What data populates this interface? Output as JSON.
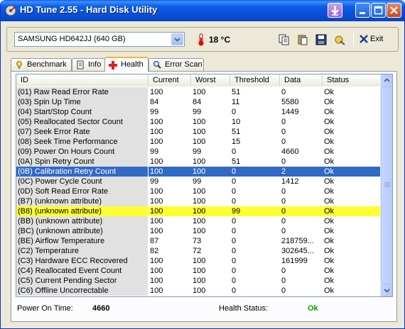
{
  "window": {
    "title": "HD Tune 2.55 - Hard Disk Utility"
  },
  "toolbar": {
    "drive": "SAMSUNG HD642JJ (640 GB)",
    "temperature": "18 °C",
    "exit_label": "Exit"
  },
  "tabs": [
    {
      "label": "Benchmark",
      "icon": "benchmark-icon",
      "active": false
    },
    {
      "label": "Info",
      "icon": "info-icon",
      "active": false
    },
    {
      "label": "Health",
      "icon": "health-cross-icon",
      "active": true
    },
    {
      "label": "Error Scan",
      "icon": "magnifier-icon",
      "active": false
    }
  ],
  "table": {
    "columns": [
      "ID",
      "Current",
      "Worst",
      "Threshold",
      "Data",
      "Status"
    ],
    "rows": [
      {
        "id": "(01) Raw Read Error Rate",
        "current": "100",
        "worst": "100",
        "threshold": "51",
        "data": "0",
        "status": "Ok"
      },
      {
        "id": "(03) Spin Up Time",
        "current": "84",
        "worst": "84",
        "threshold": "11",
        "data": "5580",
        "status": "Ok"
      },
      {
        "id": "(04) Start/Stop Count",
        "current": "99",
        "worst": "99",
        "threshold": "0",
        "data": "1449",
        "status": "Ok"
      },
      {
        "id": "(05) Reallocated Sector Count",
        "current": "100",
        "worst": "100",
        "threshold": "10",
        "data": "0",
        "status": "Ok"
      },
      {
        "id": "(07) Seek Error Rate",
        "current": "100",
        "worst": "100",
        "threshold": "51",
        "data": "0",
        "status": "Ok"
      },
      {
        "id": "(08) Seek Time Performance",
        "current": "100",
        "worst": "100",
        "threshold": "15",
        "data": "0",
        "status": "Ok"
      },
      {
        "id": "(09) Power On Hours Count",
        "current": "99",
        "worst": "99",
        "threshold": "0",
        "data": "4660",
        "status": "Ok"
      },
      {
        "id": "(0A) Spin Retry Count",
        "current": "100",
        "worst": "100",
        "threshold": "51",
        "data": "0",
        "status": "Ok"
      },
      {
        "id": "(0B) Calibration Retry Count",
        "current": "100",
        "worst": "100",
        "threshold": "0",
        "data": "2",
        "status": "Ok",
        "state": "selected"
      },
      {
        "id": "(0C) Power Cycle Count",
        "current": "99",
        "worst": "99",
        "threshold": "0",
        "data": "1412",
        "status": "Ok"
      },
      {
        "id": "(0D) Soft Read Error Rate",
        "current": "100",
        "worst": "100",
        "threshold": "0",
        "data": "0",
        "status": "Ok"
      },
      {
        "id": "(B7) (unknown attribute)",
        "current": "100",
        "worst": "100",
        "threshold": "0",
        "data": "0",
        "status": "Ok"
      },
      {
        "id": "(B8) (unknown attribute)",
        "current": "100",
        "worst": "100",
        "threshold": "99",
        "data": "0",
        "status": "Ok",
        "state": "highlight"
      },
      {
        "id": "(BB) (unknown attribute)",
        "current": "100",
        "worst": "100",
        "threshold": "0",
        "data": "0",
        "status": "Ok"
      },
      {
        "id": "(BC) (unknown attribute)",
        "current": "100",
        "worst": "100",
        "threshold": "0",
        "data": "0",
        "status": "Ok"
      },
      {
        "id": "(BE) Airflow Temperature",
        "current": "87",
        "worst": "73",
        "threshold": "0",
        "data": "218759...",
        "status": "Ok"
      },
      {
        "id": "(C2) Temperature",
        "current": "82",
        "worst": "72",
        "threshold": "0",
        "data": "302645...",
        "status": "Ok"
      },
      {
        "id": "(C3) Hardware ECC Recovered",
        "current": "100",
        "worst": "100",
        "threshold": "0",
        "data": "161999",
        "status": "Ok"
      },
      {
        "id": "(C4) Reallocated Event Count",
        "current": "100",
        "worst": "100",
        "threshold": "0",
        "data": "0",
        "status": "Ok"
      },
      {
        "id": "(C5) Current Pending Sector",
        "current": "100",
        "worst": "100",
        "threshold": "0",
        "data": "0",
        "status": "Ok"
      },
      {
        "id": "(C6) Offline Uncorrectable",
        "current": "100",
        "worst": "100",
        "threshold": "0",
        "data": "0",
        "status": "Ok"
      }
    ]
  },
  "footer": {
    "power_on_label": "Power On Time:",
    "power_on_value": "4660",
    "health_label": "Health Status:",
    "health_value": "Ok"
  },
  "colors": {
    "selected_row": "#316ac5",
    "highlight_row": "#ffff33",
    "health_ok": "#00a000",
    "title_bar": "#0a4fd4"
  }
}
